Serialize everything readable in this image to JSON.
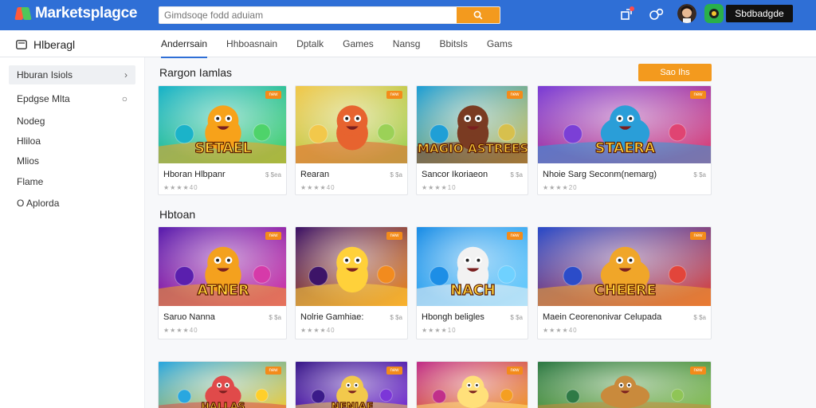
{
  "header": {
    "logo_text": "Marketsplagce",
    "search_placeholder": "Gimdsoqe fodd aduiam",
    "signin_label": "Sbdbadgde"
  },
  "subheader": {
    "title": "Hlberagl",
    "tabs": [
      "Anderrsain",
      "Hhboasnain",
      "Dptalk",
      "Games",
      "Nansg",
      "Bbitsls",
      "Gams"
    ]
  },
  "sidebar": {
    "items": [
      {
        "label": "Hburan Isiols",
        "trail": "›"
      },
      {
        "label": "Epdgse Mlta",
        "trail": "○"
      },
      {
        "label": "Nodeg",
        "trail": ""
      },
      {
        "label": "Hliloa",
        "trail": ""
      },
      {
        "label": "Mlios",
        "trail": ""
      },
      {
        "label": "Flame",
        "trail": ""
      },
      {
        "label": "O Aplorda",
        "trail": ""
      }
    ]
  },
  "rows": [
    {
      "title": "Rargon Iamlas",
      "see_all": "Sao Ihs",
      "cards": [
        {
          "title": "Hboran Hlbpanr",
          "price": "$ $ea",
          "rating": "★★★★40",
          "badge": "new",
          "art": "orange"
        },
        {
          "title": "Rearan",
          "price": "$ $a",
          "rating": "★★★★40",
          "badge": "new",
          "art": "kid"
        },
        {
          "title": "Sancor Ikoriaeon",
          "price": "$ $a",
          "rating": "★★★★10",
          "badge": "new",
          "art": "troll"
        },
        {
          "title": "Nhoie Sarg Seconm(nemarg)",
          "price": "$ $a",
          "rating": "★★★★20",
          "badge": "new",
          "art": "robot"
        }
      ]
    },
    {
      "title": "Hbtoan",
      "see_all": "",
      "cards": [
        {
          "title": "Saruo Nanna",
          "price": "$ $a",
          "rating": "★★★★40",
          "badge": "new",
          "art": "kids"
        },
        {
          "title": "Nolrie Gamhiae:",
          "price": "$ $a",
          "rating": "★★★★40",
          "badge": "new",
          "art": "dog"
        },
        {
          "title": "Hbongh beligles",
          "price": "$ $a",
          "rating": "★★★★10",
          "badge": "new",
          "art": "hero"
        },
        {
          "title": "Maein Ceorenonivar Celupada",
          "price": "$ $a",
          "rating": "★★★★40",
          "badge": "new",
          "art": "wild"
        }
      ]
    },
    {
      "title": "",
      "see_all": "",
      "cards": [
        {
          "title": "",
          "price": "",
          "rating": "",
          "badge": "new",
          "art": "halas"
        },
        {
          "title": "",
          "price": "",
          "rating": "",
          "badge": "new",
          "art": "neniae"
        },
        {
          "title": "",
          "price": "",
          "rating": "",
          "badge": "new",
          "art": "bear"
        },
        {
          "title": "",
          "price": "",
          "rating": "",
          "badge": "new",
          "art": "forest"
        }
      ]
    }
  ],
  "art_text": {
    "orange": "SETAEL",
    "troll": "MAGIO ASTREES",
    "robot": "STAERA",
    "kids": "ATNER",
    "hero": "NACH",
    "wild": "CHEERE",
    "halas": "HALLAS",
    "neniae": "NENIAE"
  },
  "colors": {
    "brand_blue": "#2f6fd6",
    "accent_orange": "#f39a1e",
    "badge_orange": "#f38b1a"
  }
}
